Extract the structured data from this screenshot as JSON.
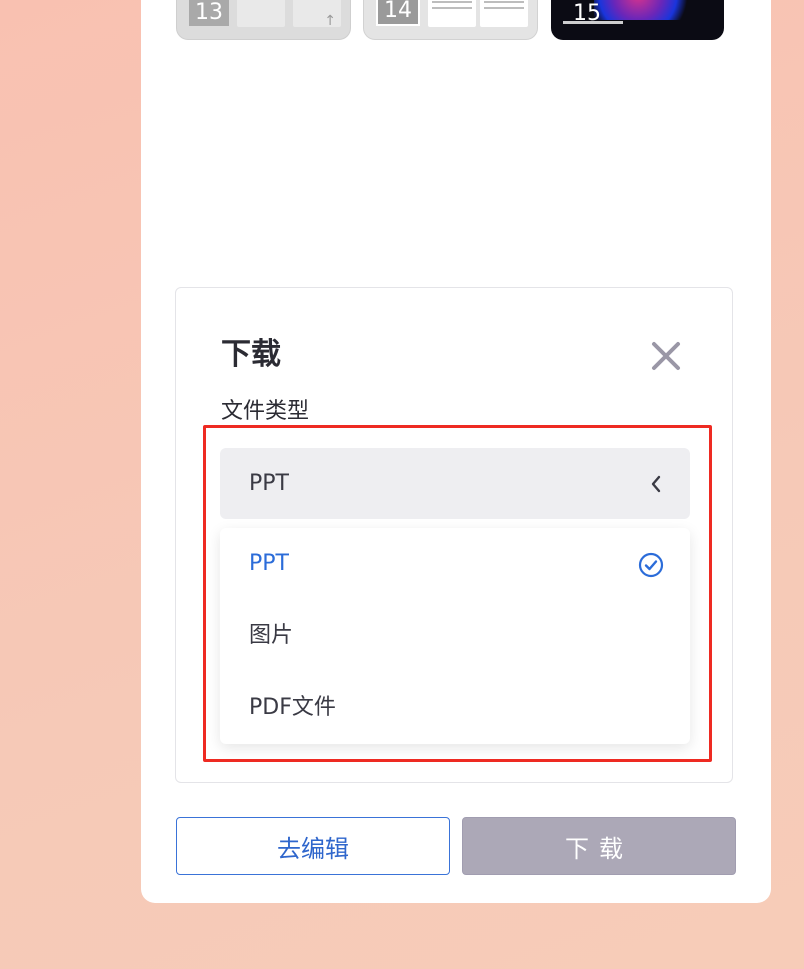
{
  "thumbnails": [
    {
      "number": "13"
    },
    {
      "number": "14"
    },
    {
      "number": "15"
    }
  ],
  "dialog": {
    "title": "下载",
    "field_label": "文件类型",
    "selected_value": "PPT",
    "options": [
      {
        "label": "PPT",
        "selected": true
      },
      {
        "label": "图片",
        "selected": false
      },
      {
        "label": "PDF文件",
        "selected": false
      }
    ]
  },
  "actions": {
    "edit_label": "去编辑",
    "download_label": "下载"
  },
  "colors": {
    "accent_blue": "#2b6cd9",
    "highlight_red": "#ee2a22",
    "download_disabled": "#aca8b7"
  },
  "icons": {
    "close": "close-icon",
    "chevron": "chevron-left-icon",
    "check": "check-circle-icon"
  }
}
